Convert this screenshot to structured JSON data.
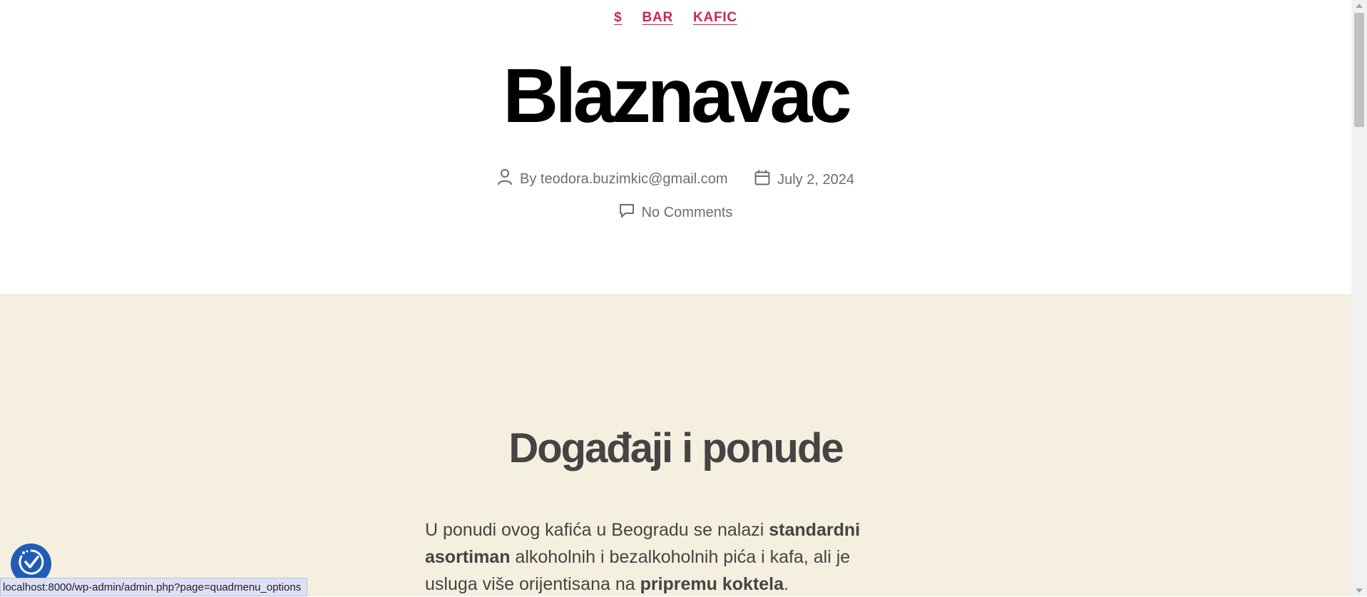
{
  "categories": [
    {
      "label": "$"
    },
    {
      "label": "BAR"
    },
    {
      "label": "KAFIC"
    }
  ],
  "post": {
    "title": "Blaznavac",
    "author_prefix": "By",
    "author": "teodora.buzimkic@gmail.com",
    "date": "July 2, 2024",
    "comments": "No Comments"
  },
  "content": {
    "heading": "Događaji i ponude",
    "paragraph": {
      "part1": "U ponudi ovog kafića u Beogradu se nalazi ",
      "bold1": "standardni asortiman",
      "part2": " alkoholnih i bezalkoholnih pića i kafa, ali je usluga više orijentisana na ",
      "bold2": "pripremu koktela",
      "part3": "."
    }
  },
  "status_bar": {
    "url": "localhost:8000/wp-admin/admin.php?page=quadmenu_options"
  },
  "colors": {
    "accent": "#cd2653",
    "content_bg": "#f5efe0",
    "heading": "#444444",
    "meta": "#6d6d6d",
    "a11y_button": "#1f5cb5"
  },
  "icons": {
    "author": "person-icon",
    "date": "calendar-icon",
    "comments": "speech-bubble-icon",
    "accessibility": "accessibility-check-icon"
  }
}
